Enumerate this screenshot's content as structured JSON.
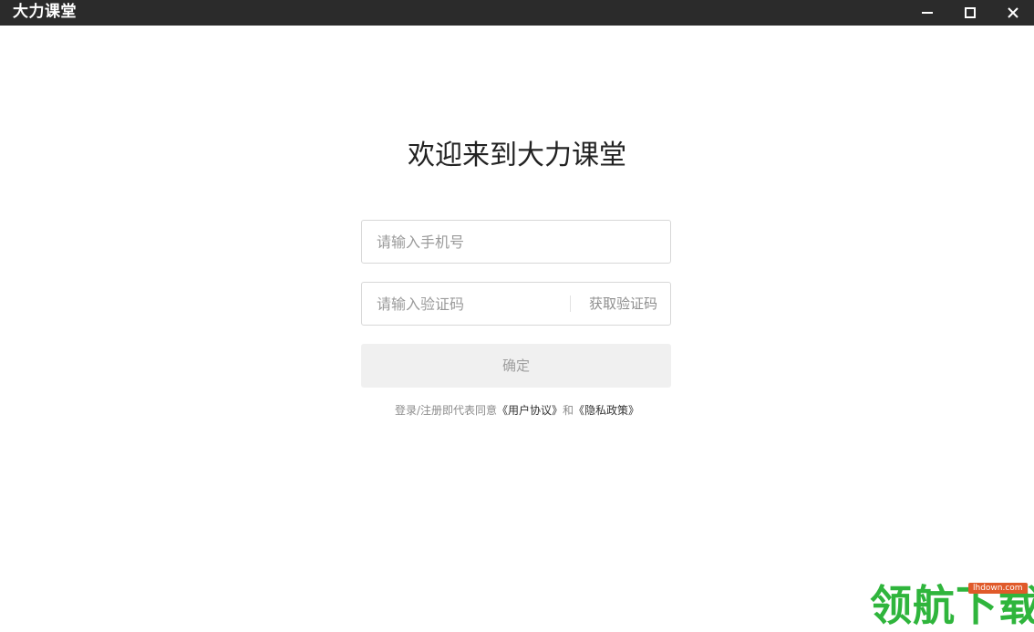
{
  "window": {
    "title": "大力课堂",
    "controls": [
      "minimize-icon",
      "maximize-icon",
      "close-icon"
    ]
  },
  "login": {
    "welcome": "欢迎来到大力课堂",
    "phone_placeholder": "请输入手机号",
    "code_placeholder": "请输入验证码",
    "get_code": "获取验证码",
    "submit": "确定",
    "agreement_prefix": "登录/注册即代表同意",
    "user_agreement": "《用户协议》",
    "agreement_and": "和",
    "privacy_policy": "《隐私政策》"
  },
  "watermark": {
    "text": "领航下载",
    "site": "lhdown.com"
  },
  "colors": {
    "titlebar": "#2b2b2b",
    "button_bg": "#f0f0f0",
    "watermark_green": "#2fb53c",
    "watermark_orange": "#e05a2a"
  }
}
